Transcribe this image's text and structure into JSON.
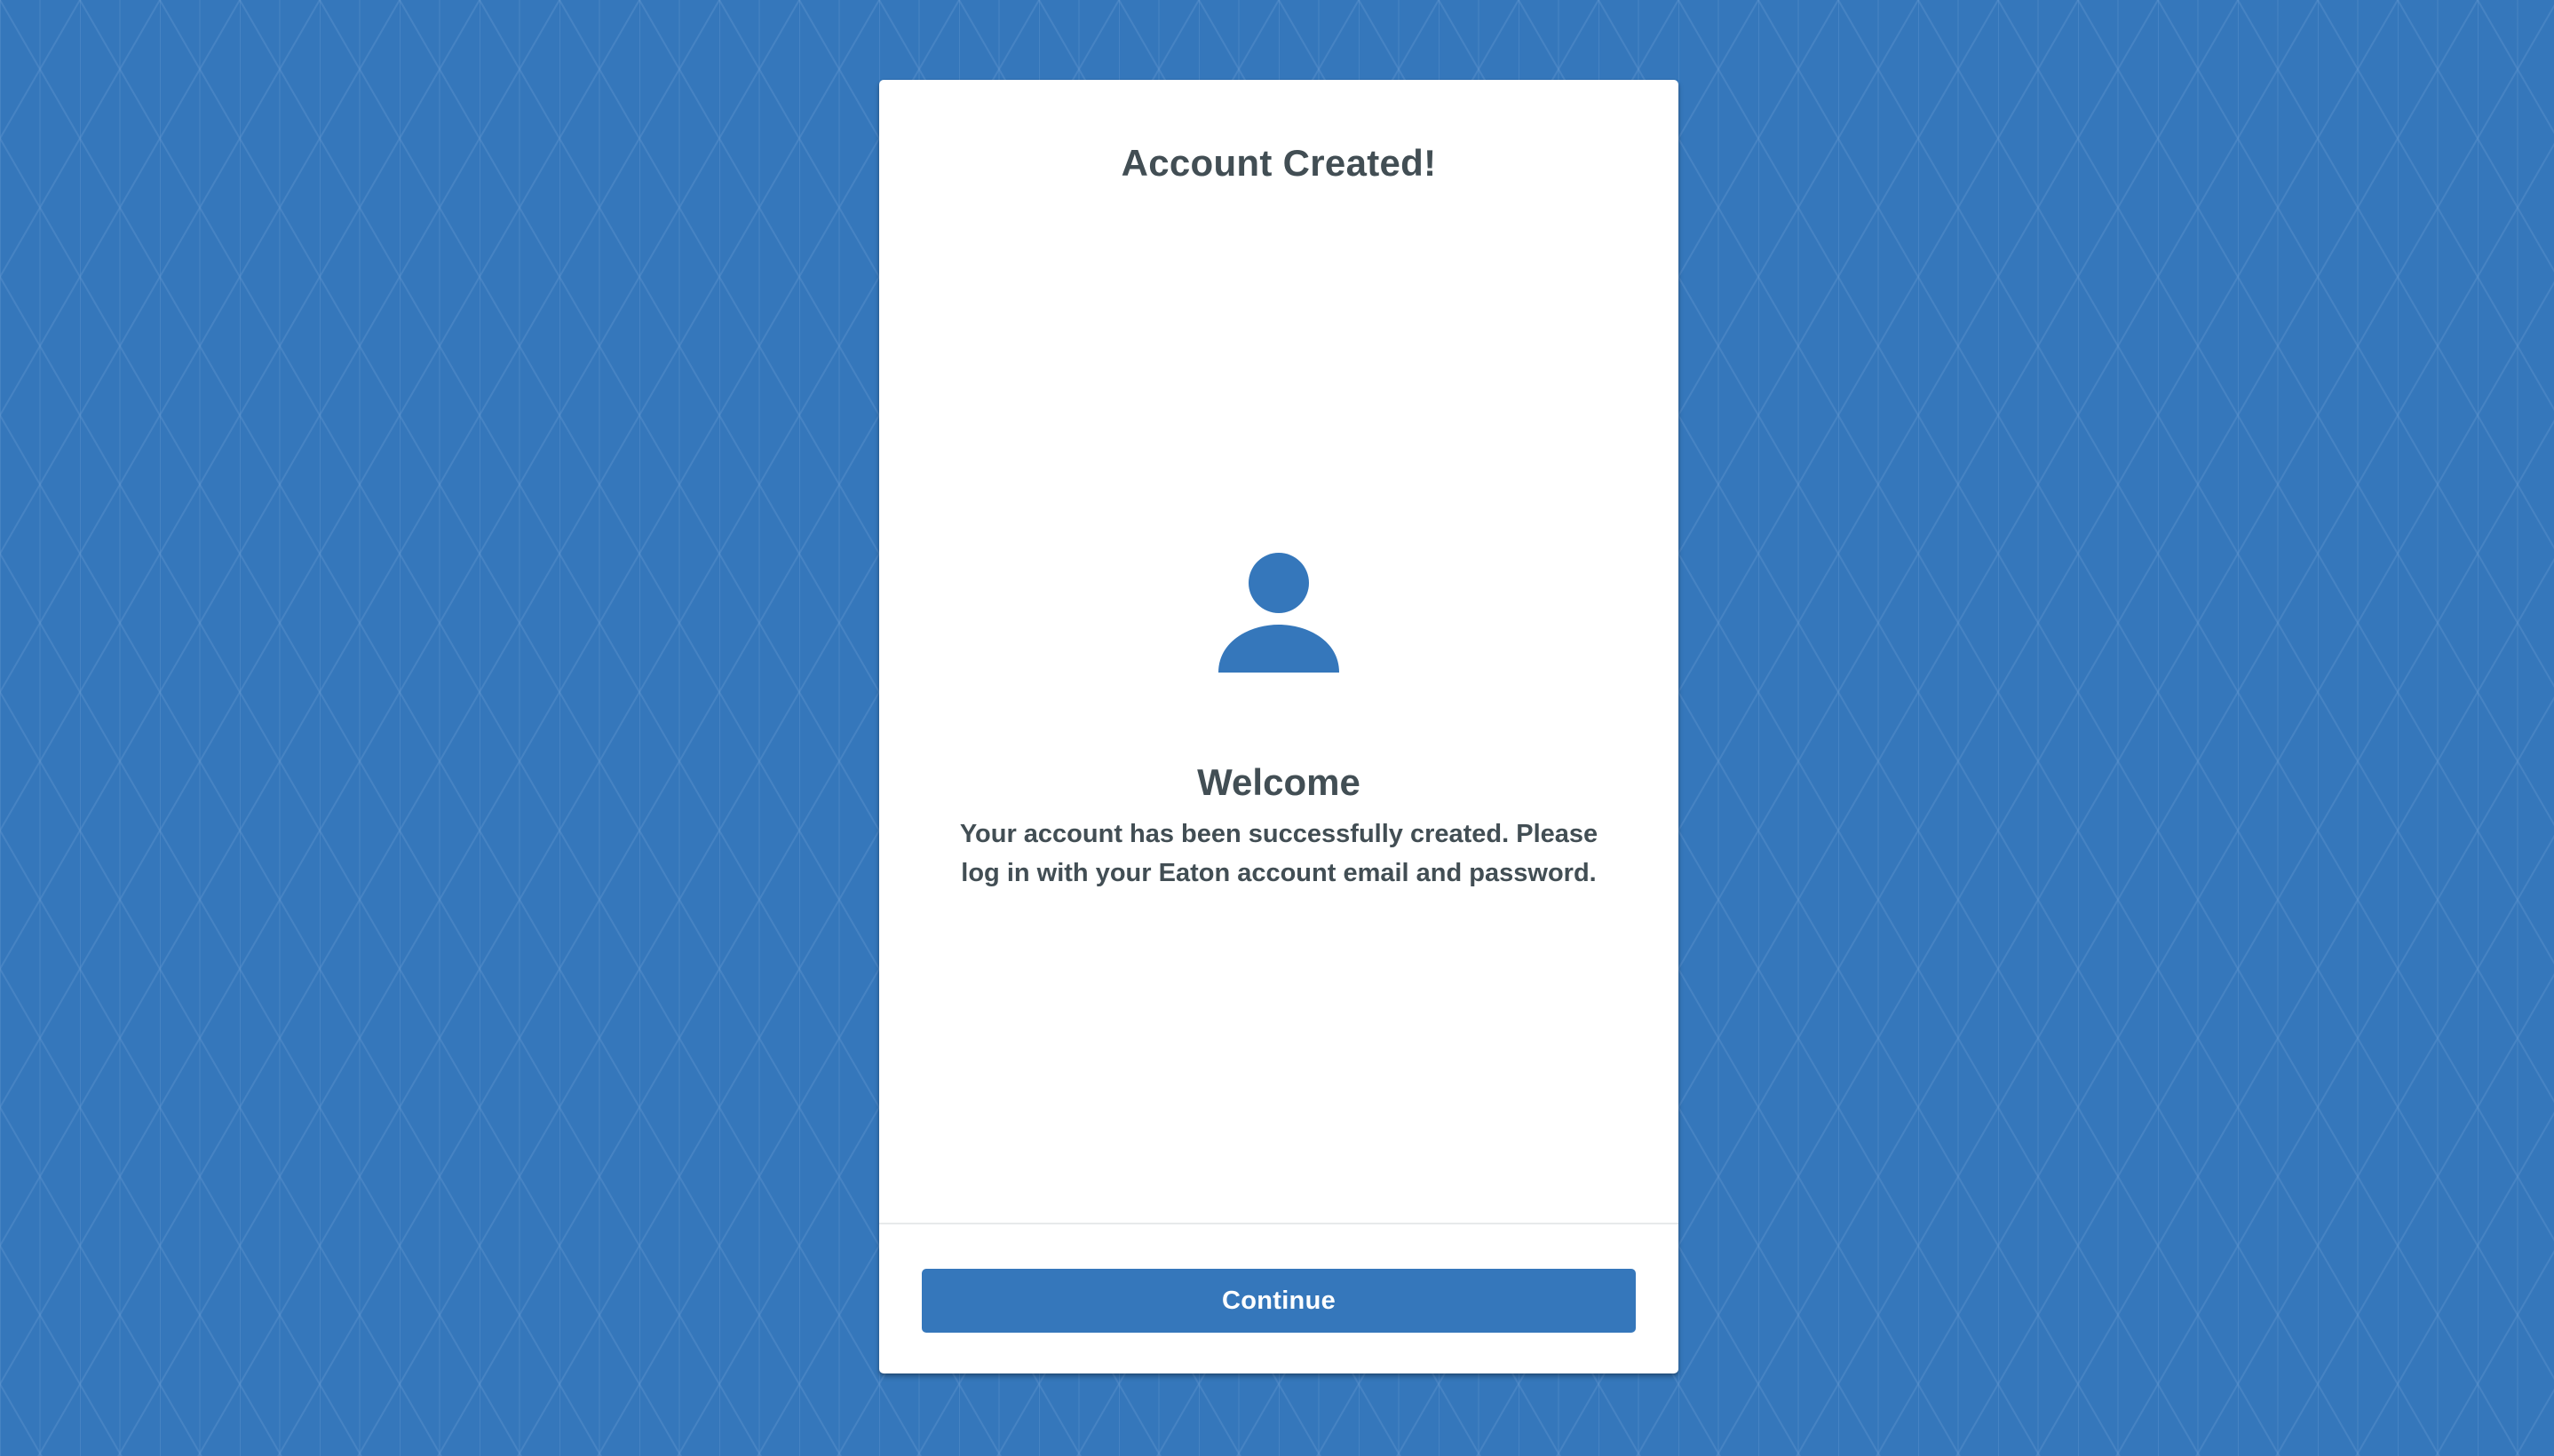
{
  "theme": {
    "background_color": "#3577bb",
    "card_color": "#ffffff",
    "text_color": "#424e54",
    "accent_color": "#3577bb"
  },
  "card": {
    "title": "Account Created!",
    "icon": "person-icon",
    "welcome_heading": "Welcome",
    "welcome_message": "Your account has been successfully created. Please log in with your Eaton account email and password.",
    "continue_label": "Continue"
  }
}
